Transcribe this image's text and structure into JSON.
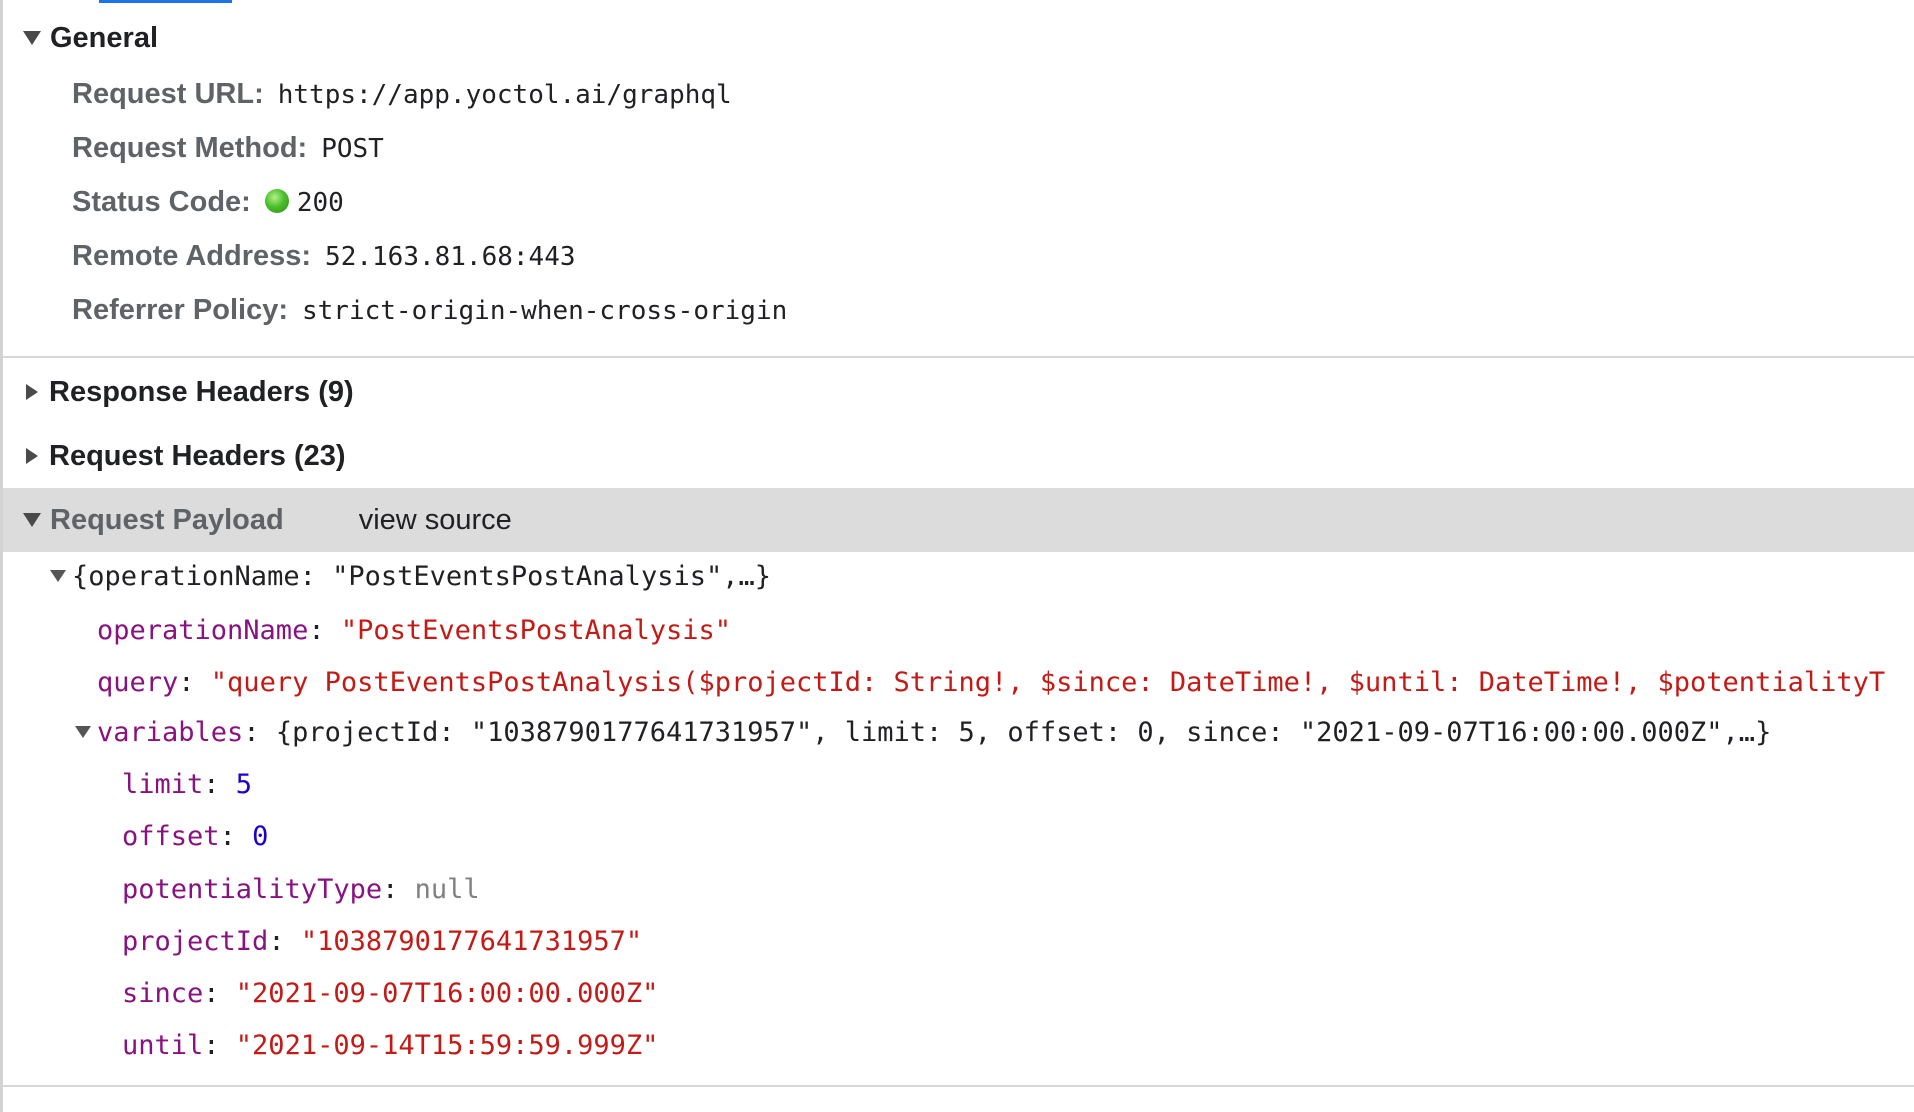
{
  "general": {
    "title": "General",
    "rows": [
      {
        "key": "Request URL:",
        "value": "https://app.yoctol.ai/graphql"
      },
      {
        "key": "Request Method:",
        "value": "POST"
      },
      {
        "key": "Status Code:",
        "value": "200"
      },
      {
        "key": "Remote Address:",
        "value": "52.163.81.68:443"
      },
      {
        "key": "Referrer Policy:",
        "value": "strict-origin-when-cross-origin"
      }
    ],
    "status_color": "#4cbf2c"
  },
  "response_headers": {
    "title": "Response Headers",
    "count": "(9)"
  },
  "request_headers": {
    "title": "Request Headers",
    "count": "(23)"
  },
  "payload": {
    "title": "Request Payload",
    "view_source": "view source",
    "root_summary": "{operationName: \"PostEventsPostAnalysis\",…}",
    "operationName": {
      "key": "operationName",
      "value": "\"PostEventsPostAnalysis\""
    },
    "query": {
      "key": "query",
      "value": "\"query PostEventsPostAnalysis($projectId: String!, $since: DateTime!, $until: DateTime!, $potentialityT"
    },
    "variables": {
      "key": "variables",
      "summary": "{projectId: \"1038790177641731957\", limit: 5, offset: 0, since: \"2021-09-07T16:00:00.000Z\",…}",
      "items": [
        {
          "key": "limit",
          "value": "5",
          "type": "number"
        },
        {
          "key": "offset",
          "value": "0",
          "type": "number"
        },
        {
          "key": "potentialityType",
          "value": "null",
          "type": "null"
        },
        {
          "key": "projectId",
          "value": "\"1038790177641731957\"",
          "type": "string"
        },
        {
          "key": "since",
          "value": "\"2021-09-07T16:00:00.000Z\"",
          "type": "string"
        },
        {
          "key": "until",
          "value": "\"2021-09-14T15:59:59.999Z\"",
          "type": "string"
        }
      ]
    }
  },
  "colors": {
    "key": "#881280",
    "string": "#c41a16",
    "number": "#1c00cf",
    "null": "#808080",
    "header_bg": "#dcdcdc"
  }
}
